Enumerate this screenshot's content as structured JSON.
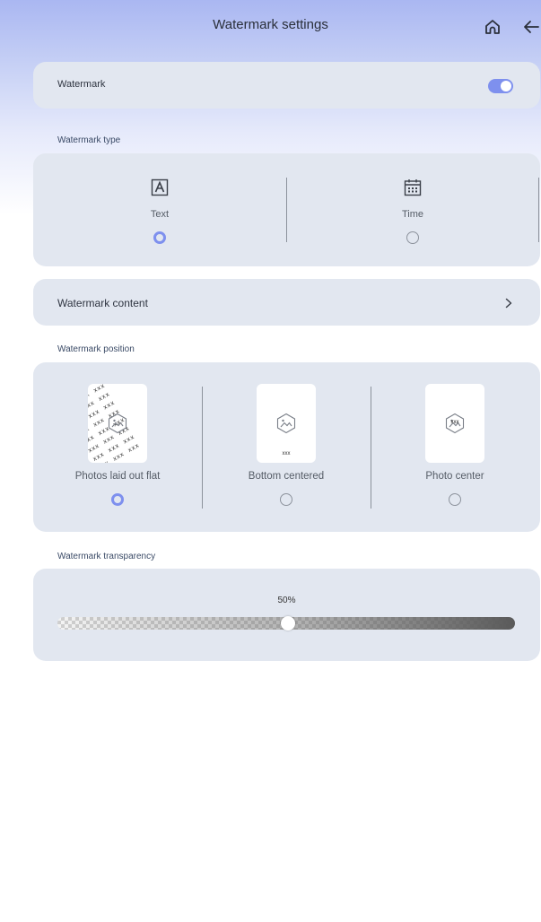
{
  "header": {
    "title": "Watermark settings",
    "home_icon": "home-icon",
    "back_icon": "back-arrow-icon"
  },
  "watermark_toggle": {
    "label": "Watermark",
    "enabled": true
  },
  "watermark_type": {
    "label": "Watermark type",
    "options": [
      {
        "label": "Text",
        "icon": "text-a-icon",
        "selected": true
      },
      {
        "label": "Time",
        "icon": "calendar-icon",
        "selected": false
      }
    ]
  },
  "watermark_content": {
    "label": "Watermark content",
    "icon": "chevron-right-icon"
  },
  "watermark_position": {
    "label": "Watermark position",
    "options": [
      {
        "label": "Photos laid out flat",
        "thumb_text": "xxx",
        "selected": true
      },
      {
        "label": "Bottom centered",
        "thumb_text": "xxx",
        "selected": false
      },
      {
        "label": "Photo center",
        "thumb_text": "xxx",
        "selected": false
      }
    ]
  },
  "watermark_transparency": {
    "label": "Watermark transparency",
    "value_text": "50%",
    "value": 0.5
  },
  "colors": {
    "accent": "#7e90ee",
    "card": "#e2e7f0"
  }
}
